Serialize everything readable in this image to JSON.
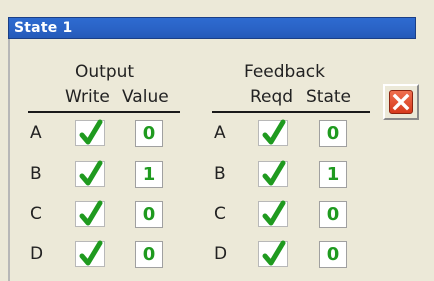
{
  "window": {
    "title": "State 1"
  },
  "output": {
    "heading": "Output",
    "col_write": "Write",
    "col_value": "Value",
    "rows": [
      {
        "label": "A",
        "write_checked": true,
        "value": "0"
      },
      {
        "label": "B",
        "write_checked": true,
        "value": "1"
      },
      {
        "label": "C",
        "write_checked": true,
        "value": "0"
      },
      {
        "label": "D",
        "write_checked": true,
        "value": "0"
      }
    ]
  },
  "feedback": {
    "heading": "Feedback",
    "col_reqd": "Reqd",
    "col_state": "State",
    "rows": [
      {
        "label": "A",
        "reqd_checked": true,
        "state": "0"
      },
      {
        "label": "B",
        "reqd_checked": true,
        "state": "1"
      },
      {
        "label": "C",
        "reqd_checked": true,
        "state": "0"
      },
      {
        "label": "D",
        "reqd_checked": true,
        "state": "0"
      }
    ]
  },
  "icons": {
    "close": "close-icon",
    "check": "checkmark-icon"
  },
  "colors": {
    "title_bar": "#2a63c6",
    "check_green": "#1f9a1f",
    "close_red": "#d6391c"
  }
}
